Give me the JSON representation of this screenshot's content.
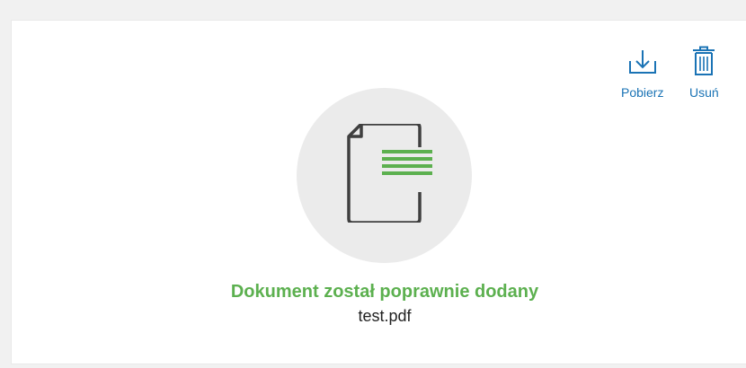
{
  "actions": {
    "download": {
      "label": "Pobierz",
      "icon": "download-icon"
    },
    "delete": {
      "label": "Usuń",
      "icon": "trash-icon"
    }
  },
  "document": {
    "icon": "document-icon",
    "status_message": "Dokument został poprawnie dodany",
    "file_name": "test.pdf"
  },
  "colors": {
    "action": "#1a73b5",
    "success": "#5cb04f",
    "icon_stroke": "#3f3f3f",
    "circle_bg": "#ebebeb"
  }
}
